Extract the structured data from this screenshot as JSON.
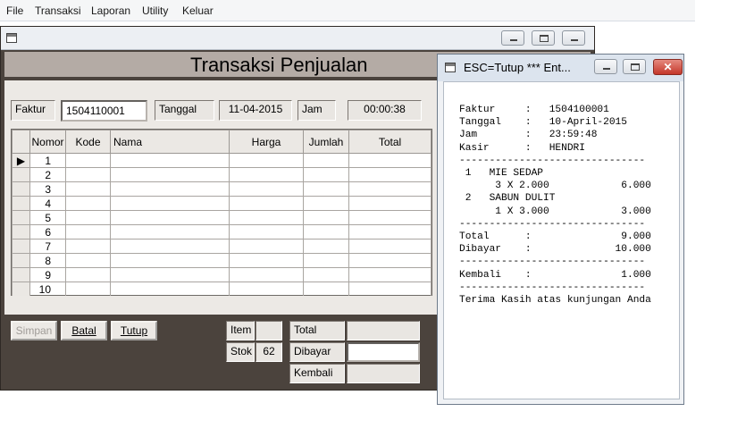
{
  "menu": {
    "items": [
      "File",
      "Transaksi",
      "Laporan",
      "Utility",
      "Keluar"
    ]
  },
  "main": {
    "title": "Transaksi Penjualan",
    "faktur_label": "Faktur",
    "faktur_value": "1504110001",
    "tanggal_label": "Tanggal",
    "tanggal_value": "11-04-2015",
    "jam_label": "Jam",
    "jam_value": "00:00:38",
    "grid": {
      "columns": [
        "Nomor",
        "Kode",
        "Nama",
        "Harga",
        "Jumlah",
        "Total"
      ],
      "rows": [
        "1",
        "2",
        "3",
        "4",
        "5",
        "6",
        "7",
        "8",
        "9",
        "10"
      ],
      "selected_row_marker": "▶"
    },
    "buttons": {
      "simpan": "Simpan",
      "batal": "Batal",
      "tutup": "Tutup"
    },
    "item_label": "Item",
    "item_value": "",
    "stok_label": "Stok",
    "stok_value": "62",
    "total_label": "Total",
    "total_value": "",
    "dibayar_label": "Dibayar",
    "dibayar_value": "",
    "kembali_label": "Kembali",
    "kembali_value": ""
  },
  "receipt": {
    "title": "ESC=Tutup  ***  Ent...",
    "close_glyph": "✕",
    "text": "Faktur     :   1504100001\nTanggal    :   10-April-2015\nJam        :   23:59:48\nKasir      :   HENDRI\n-------------------------------\n 1   MIE SEDAP\n      3 X 2.000            6.000\n 2   SABUN DULIT\n      1 X 3.000            3.000\n-------------------------------\nTotal      :               9.000\nDibayar    :              10.000\n-------------------------------\nKembali    :               1.000\n-------------------------------\nTerima Kasih atas kunjungan Anda"
  },
  "colors": {
    "window_bg": "#4b433d",
    "panel_bg": "#ece9e5",
    "title_band": "#b4aba5",
    "close_red": "#c4372a"
  }
}
